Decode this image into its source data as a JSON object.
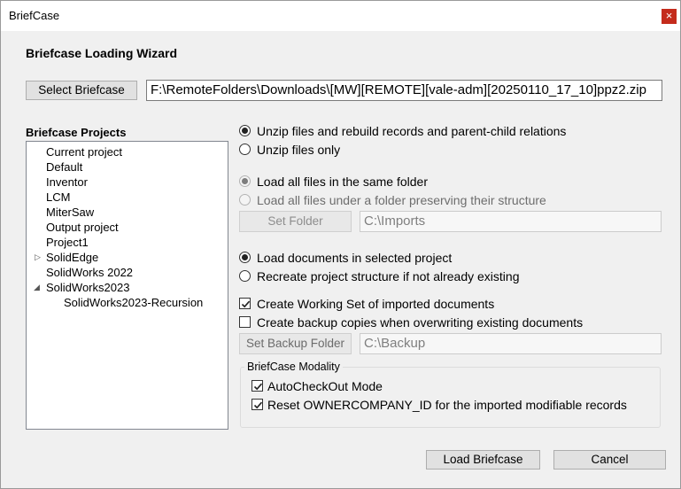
{
  "window": {
    "title": "BriefCase",
    "close_glyph": "×"
  },
  "wizard": {
    "heading": "Briefcase Loading Wizard"
  },
  "select": {
    "button_label": "Select Briefcase",
    "path": "F:\\RemoteFolders\\Downloads\\[MW][REMOTE][vale-adm][20250110_17_10]ppz2.zip"
  },
  "projects": {
    "label": "Briefcase Projects",
    "items": [
      "Current project",
      "Default",
      "Inventor",
      "LCM",
      "MiterSaw",
      "Output project",
      "Project1",
      "SolidEdge",
      "SolidWorks 2022",
      "SolidWorks2023",
      "SolidWorks2023-Recursion"
    ]
  },
  "unzip": {
    "option_rebuild": "Unzip files and rebuild  records and parent-child relations",
    "option_only": "Unzip files only"
  },
  "load_files": {
    "same_folder": "Load all files in the same folder",
    "preserve_structure": "Load all files under a  folder preserving their structure",
    "set_folder_label": "Set Folder",
    "folder_value": "C:\\Imports"
  },
  "documents": {
    "selected_project": "Load documents in selected project",
    "recreate": "Recreate project structure if not already existing",
    "working_set": "Create Working Set of imported documents",
    "backup": "Create backup copies when overwriting existing documents",
    "set_backup_label": "Set Backup Folder",
    "backup_value": "C:\\Backup"
  },
  "modality": {
    "title": "BriefCase Modality",
    "autocheckout": "AutoCheckOut Mode",
    "reset_owner": "Reset OWNERCOMPANY_ID for the imported modifiable records"
  },
  "actions": {
    "load": "Load Briefcase",
    "cancel": "Cancel"
  }
}
